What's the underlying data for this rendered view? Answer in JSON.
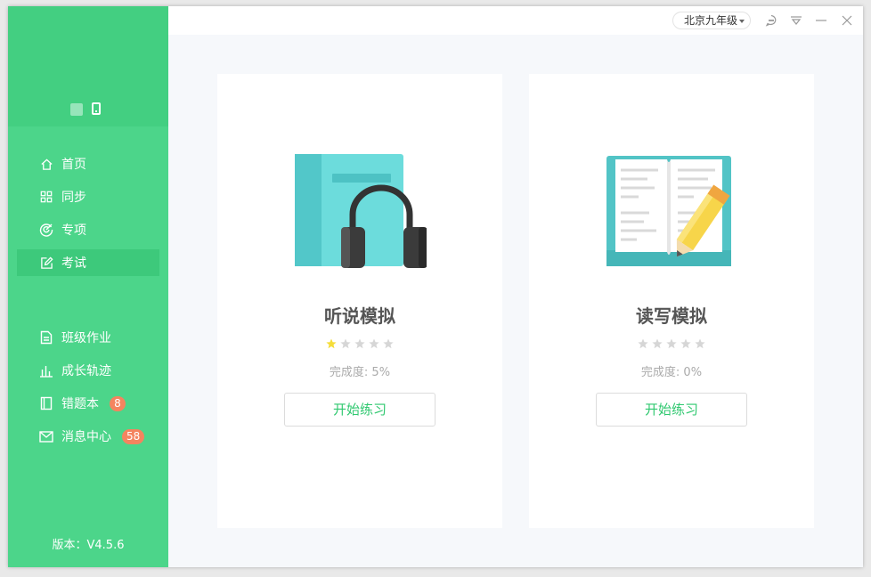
{
  "sidebar": {
    "items_top": [
      {
        "label": "首页",
        "icon": "home-icon"
      },
      {
        "label": "同步",
        "icon": "grid-icon"
      },
      {
        "label": "专项",
        "icon": "target-icon"
      },
      {
        "label": "考试",
        "icon": "edit-icon",
        "active": true
      }
    ],
    "items_bottom": [
      {
        "label": "班级作业",
        "icon": "document-icon"
      },
      {
        "label": "成长轨迹",
        "icon": "bar-chart-icon"
      },
      {
        "label": "错题本",
        "icon": "notebook-icon",
        "badge": "8"
      },
      {
        "label": "消息中心",
        "icon": "mail-icon",
        "badge": "58"
      }
    ],
    "version": "版本：V4.5.6"
  },
  "titlebar": {
    "grade": "北京九年级"
  },
  "cards": [
    {
      "title": "听说模拟",
      "stars_filled": 1,
      "stars_total": 5,
      "progress": "完成度: 5%",
      "button": "开始练习",
      "icon": "headphones-book-icon"
    },
    {
      "title": "读写模拟",
      "stars_filled": 0,
      "stars_total": 5,
      "progress": "完成度: 0%",
      "button": "开始练习",
      "icon": "open-book-pencil-icon"
    }
  ],
  "colors": {
    "sidebar": "#4cd58a",
    "accent": "#2fc86f",
    "badge": "#f4845f",
    "star_filled": "#f5dd3a",
    "star_empty": "#d6d6d6"
  }
}
